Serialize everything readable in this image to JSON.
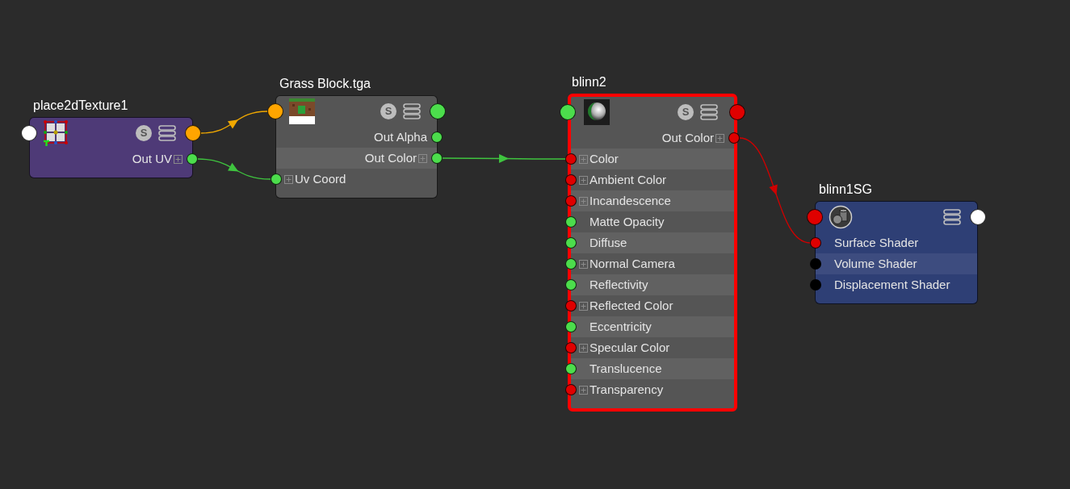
{
  "nodes": [
    {
      "title": "place2dTexture1",
      "color": "#4e3a77",
      "selected": false,
      "kind": "placement",
      "badge": "S",
      "input_port": {
        "color": "#ffffff"
      },
      "output_port": {
        "color": "#ffa500"
      },
      "rows": [
        {
          "label": "Out UV",
          "kind": "output",
          "expandable": true,
          "color": "#4cdd4c"
        }
      ]
    },
    {
      "title": "Grass Block.tga",
      "color": "#555555",
      "selected": false,
      "kind": "texture",
      "badge": "S",
      "input_port": {
        "color": "#ffa500"
      },
      "output_port": {
        "color": "#4cdd4c"
      },
      "rows": [
        {
          "label": "Out Alpha",
          "kind": "output",
          "expandable": false,
          "color": "#4cdd4c"
        },
        {
          "label": "Out Color",
          "kind": "output",
          "expandable": true,
          "color": "#4cdd4c"
        },
        {
          "label": "Uv Coord",
          "kind": "input",
          "expandable": true,
          "color": "#4cdd4c"
        }
      ]
    },
    {
      "title": "blinn2",
      "color": "#555555",
      "selected": true,
      "kind": "material",
      "badge": "S",
      "input_port": {
        "color": "#4cdd4c"
      },
      "output_port": {
        "color": "#e00000"
      },
      "rows": [
        {
          "label": "Out Color",
          "kind": "output",
          "expandable": true,
          "color": "#e00000"
        },
        {
          "label": "Color",
          "kind": "input",
          "expandable": true,
          "color": "#e00000"
        },
        {
          "label": "Ambient Color",
          "kind": "input",
          "expandable": true,
          "color": "#e00000"
        },
        {
          "label": "Incandescence",
          "kind": "input",
          "expandable": true,
          "color": "#e00000"
        },
        {
          "label": "Matte Opacity",
          "kind": "input",
          "expandable": false,
          "color": "#4cdd4c"
        },
        {
          "label": "Diffuse",
          "kind": "input",
          "expandable": false,
          "color": "#4cdd4c"
        },
        {
          "label": "Normal Camera",
          "kind": "input",
          "expandable": true,
          "color": "#4cdd4c"
        },
        {
          "label": "Reflectivity",
          "kind": "input",
          "expandable": false,
          "color": "#4cdd4c"
        },
        {
          "label": "Reflected Color",
          "kind": "input",
          "expandable": true,
          "color": "#e00000"
        },
        {
          "label": "Eccentricity",
          "kind": "input",
          "expandable": false,
          "color": "#4cdd4c"
        },
        {
          "label": "Specular Color",
          "kind": "input",
          "expandable": true,
          "color": "#e00000"
        },
        {
          "label": "Translucence",
          "kind": "input",
          "expandable": false,
          "color": "#4cdd4c"
        },
        {
          "label": "Transparency",
          "kind": "input",
          "expandable": true,
          "color": "#e00000"
        }
      ]
    },
    {
      "title": "blinn1SG",
      "color": "#2e3f75",
      "selected": false,
      "kind": "group",
      "input_port": {
        "color": "#e00000"
      },
      "output_port": {
        "color": "#ffffff"
      },
      "rows": [
        {
          "label": "Surface Shader",
          "kind": "input",
          "expandable": false,
          "color": "#e00000"
        },
        {
          "label": "Volume Shader",
          "kind": "input",
          "expandable": false,
          "color": "#000000"
        },
        {
          "label": "Displacement Shader",
          "kind": "input",
          "expandable": false,
          "color": "#000000"
        }
      ]
    }
  ],
  "connections": [
    {
      "color": "#f0a800"
    },
    {
      "color": "#3fc43f"
    },
    {
      "color": "#3fc43f"
    },
    {
      "color": "#d00000"
    }
  ]
}
